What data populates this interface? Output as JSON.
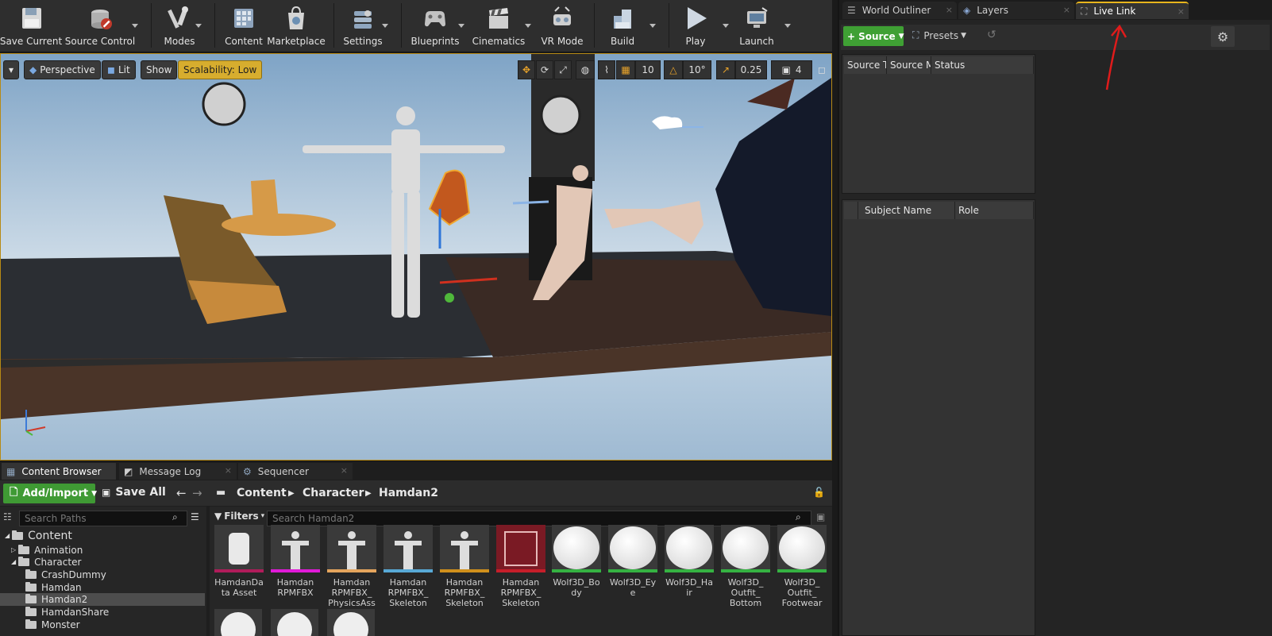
{
  "toolbar": {
    "buttons": [
      {
        "label": "Save Current",
        "icon": "save-icon"
      },
      {
        "label": "Source Control",
        "icon": "source-control-icon"
      },
      {
        "label": "Modes",
        "icon": "modes-icon"
      },
      {
        "label": "Content",
        "icon": "content-icon"
      },
      {
        "label": "Marketplace",
        "icon": "marketplace-icon"
      },
      {
        "label": "Settings",
        "icon": "settings-icon"
      },
      {
        "label": "Blueprints",
        "icon": "blueprints-icon"
      },
      {
        "label": "Cinematics",
        "icon": "cinematics-icon"
      },
      {
        "label": "VR Mode",
        "icon": "vr-mode-icon"
      },
      {
        "label": "Build",
        "icon": "build-icon"
      },
      {
        "label": "Play",
        "icon": "play-icon"
      },
      {
        "label": "Launch",
        "icon": "launch-icon"
      }
    ]
  },
  "viewport": {
    "perspective": "Perspective",
    "lit": "Lit",
    "show": "Show",
    "scalability": "Scalability: Low",
    "grid_snap": "10",
    "rotation_snap": "10°",
    "scale_snap": "0.25",
    "camera_speed": "4"
  },
  "right_panel": {
    "tabs": [
      "World Outliner",
      "Layers",
      "Live Link"
    ],
    "source_button": "Source",
    "presets_button": "Presets",
    "source_columns": [
      "Source T",
      "Source M",
      "Status"
    ],
    "subject_columns": [
      "Subject Name",
      "Role"
    ]
  },
  "bottom": {
    "tabs": [
      "Content Browser",
      "Message Log",
      "Sequencer"
    ],
    "add_import": "Add/Import",
    "save_all": "Save All",
    "breadcrumb": [
      "Content",
      "Character",
      "Hamdan2"
    ],
    "search_paths_placeholder": "Search Paths",
    "filters": "Filters",
    "search_assets_placeholder": "Search Hamdan2",
    "tree": [
      {
        "label": "Content",
        "level": 0,
        "selected": false
      },
      {
        "label": "Animation",
        "level": 1,
        "selected": false
      },
      {
        "label": "Character",
        "level": 1,
        "selected": false
      },
      {
        "label": "CrashDummy",
        "level": 2,
        "selected": false
      },
      {
        "label": "Hamdan",
        "level": 2,
        "selected": false
      },
      {
        "label": "Hamdan2",
        "level": 2,
        "selected": true
      },
      {
        "label": "HamdanShare",
        "level": 2,
        "selected": false
      },
      {
        "label": "Monster",
        "level": 2,
        "selected": false
      }
    ],
    "assets": [
      {
        "name": "HamdanData Asset",
        "color": "#b01c5a"
      },
      {
        "name": "Hamdan RPMFBX",
        "color": "#e01ad8"
      },
      {
        "name": "Hamdan RPMFBX_ PhysicsAsset",
        "color": "#e5a55d"
      },
      {
        "name": "Hamdan RPMFBX_ Skeleton",
        "color": "#58a9d6"
      },
      {
        "name": "Hamdan RPMFBX_ Skeleton",
        "color": "#d0901c"
      },
      {
        "name": "Hamdan RPMFBX_ Skeleton",
        "color": "#c61e2a"
      },
      {
        "name": "Wolf3D_Body",
        "color": "#35b242"
      },
      {
        "name": "Wolf3D_Eye",
        "color": "#35b242"
      },
      {
        "name": "Wolf3D_Hair",
        "color": "#35b242"
      },
      {
        "name": "Wolf3D_ Outfit_ Bottom",
        "color": "#35b242"
      },
      {
        "name": "Wolf3D_ Outfit_ Footwear",
        "color": "#35b242"
      }
    ]
  }
}
